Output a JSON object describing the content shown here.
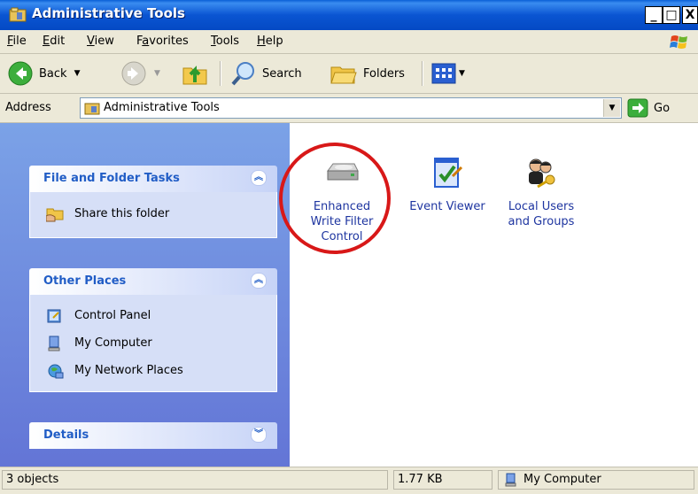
{
  "window": {
    "title": "Administrative Tools"
  },
  "menu": [
    {
      "label": "File",
      "key": "F"
    },
    {
      "label": "Edit",
      "key": "E"
    },
    {
      "label": "View",
      "key": "V"
    },
    {
      "label": "Favorites",
      "key": "a"
    },
    {
      "label": "Tools",
      "key": "T"
    },
    {
      "label": "Help",
      "key": "H"
    }
  ],
  "toolbar": {
    "back_label": "Back",
    "search_label": "Search",
    "folders_label": "Folders"
  },
  "address": {
    "label": "Address",
    "value": "Administrative Tools",
    "go_label": "Go"
  },
  "task_panels": [
    {
      "title": "File and Folder Tasks",
      "links": [
        "Share this folder"
      ]
    },
    {
      "title": "Other Places",
      "links": [
        "Control Panel",
        "My Computer",
        "My Network Places"
      ]
    },
    {
      "title": "Details",
      "links": []
    }
  ],
  "items": [
    {
      "label_lines": [
        "Enhanced",
        "Write Filter",
        "Control"
      ],
      "icon": "drive-icon",
      "highlighted": true
    },
    {
      "label_lines": [
        "Event Viewer"
      ],
      "icon": "event-viewer-icon"
    },
    {
      "label_lines": [
        "Local Users",
        "and Groups"
      ],
      "icon": "users-key-icon"
    }
  ],
  "status": {
    "objects": "3 objects",
    "size": "1.77 KB",
    "location": "My Computer"
  },
  "colors": {
    "title_bar": "#0a55d2",
    "task_pane": "#7ba2e7",
    "highlight_ring": "#d81818",
    "link_blue": "#215dc6"
  }
}
